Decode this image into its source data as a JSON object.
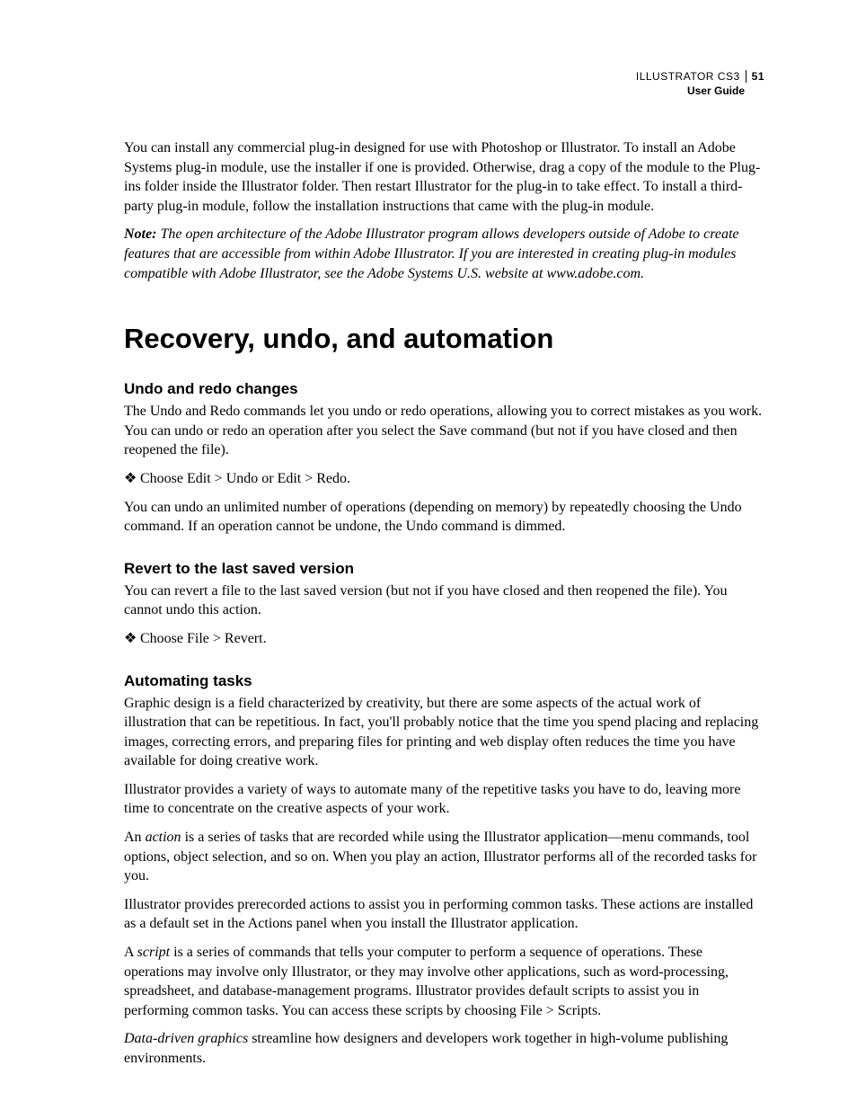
{
  "header": {
    "product": "ILLUSTRATOR CS3",
    "guide": "User Guide",
    "page_number": "51"
  },
  "intro": {
    "p1": "You can install any commercial plug-in designed for use with Photoshop or Illustrator. To install an Adobe Systems plug-in module, use the installer if one is provided. Otherwise, drag a copy of the module to the Plug-ins folder inside the Illustrator folder. Then restart Illustrator for the plug-in to take effect. To install a third-party plug-in module, follow the installation instructions that came with the plug-in module.",
    "note_label": "Note:",
    "note_body": " The open architecture of the Adobe Illustrator program allows developers outside of Adobe to create features that are accessible from within Adobe Illustrator. If you are interested in creating plug-in modules compatible with Adobe Illustrator, see the Adobe Systems U.S. website at www.adobe.com."
  },
  "section_title": "Recovery, undo, and automation",
  "undo": {
    "heading": "Undo and redo changes",
    "p1": "The Undo and Redo commands let you undo or redo operations, allowing you to correct mistakes as you work. You can undo or redo an operation after you select the Save command (but not if you have closed and then reopened the file).",
    "bullet": "Choose Edit > Undo or Edit > Redo.",
    "p2": "You can undo an unlimited number of operations (depending on memory) by repeatedly choosing the Undo command. If an operation cannot be undone, the Undo command is dimmed."
  },
  "revert": {
    "heading": "Revert to the last saved version",
    "p1": "You can revert a file to the last saved version (but not if you have closed and then reopened the file). You cannot undo this action.",
    "bullet": "Choose File > Revert."
  },
  "auto": {
    "heading": "Automating tasks",
    "p1": "Graphic design is a field characterized by creativity, but there are some aspects of the actual work of illustration that can be repetitious. In fact, you'll probably notice that the time you spend placing and replacing images, correcting errors, and preparing files for printing and web display often reduces the time you have available for doing creative work.",
    "p2": "Illustrator provides a variety of ways to automate many of the repetitive tasks you have to do, leaving more time to concentrate on the creative aspects of your work.",
    "p3a": "An ",
    "p3_em": "action",
    "p3b": " is a series of tasks that are recorded while using the Illustrator application—menu commands, tool options, object selection, and so on. When you play an action, Illustrator performs all of the recorded tasks for you.",
    "p4": "Illustrator provides prerecorded actions to assist you in performing common tasks. These actions are installed as a default set in the Actions panel when you install the Illustrator application.",
    "p5a": "A ",
    "p5_em": "script",
    "p5b": " is a series of commands that tells your computer to perform a sequence of operations. These operations may involve only Illustrator, or they may involve other applications, such as word-processing, spreadsheet, and database-management programs. Illustrator provides default scripts to assist you in performing common tasks. You can access these scripts by choosing File > Scripts.",
    "p6_em": "Data-driven graphics",
    "p6b": " streamline how designers and developers work together in high-volume publishing environments."
  },
  "glyphs": {
    "diamond": "❖"
  }
}
